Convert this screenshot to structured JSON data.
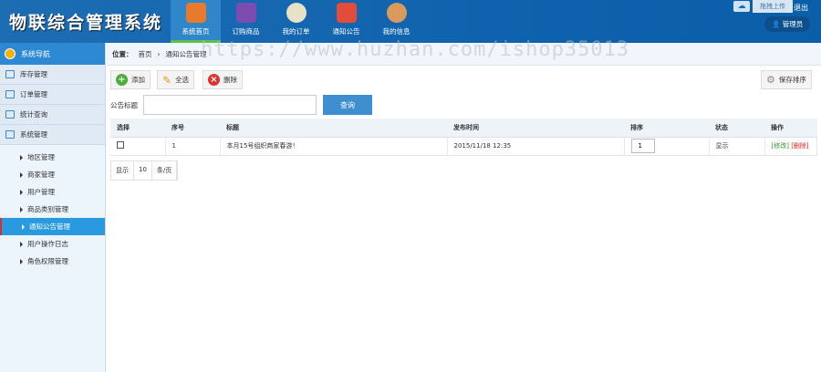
{
  "app_title": "物联综合管理系统",
  "nav": [
    {
      "label": "系统首页",
      "icon": "home-icon",
      "color": "#e87a2f"
    },
    {
      "label": "订购商品",
      "icon": "phone-icon",
      "color": "#7b4db0"
    },
    {
      "label": "我的订单",
      "icon": "support-icon",
      "color": "#e7e1c8"
    },
    {
      "label": "通知公告",
      "icon": "megaphone-icon",
      "color": "#e24c3a"
    },
    {
      "label": "我的信息",
      "icon": "user-icon",
      "color": "#d99a5b"
    }
  ],
  "top": {
    "upload": "拖拽上传",
    "logout": "退出",
    "user": "管理员"
  },
  "sidebar": {
    "title": "系统导航",
    "menus": [
      "库存管理",
      "订单管理",
      "统计查询",
      "系统管理"
    ],
    "subs": [
      "地区管理",
      "商家管理",
      "用户管理",
      "商品类别管理",
      "通知公告管理",
      "用户操作日志",
      "角色权限管理"
    ]
  },
  "breadcrumb": {
    "label": "位置：",
    "home": "首页",
    "sep": "›",
    "current": "通知公告管理"
  },
  "toolbar": {
    "add": "添加",
    "select_all": "全选",
    "delete": "删除",
    "save_sort": "保存排序"
  },
  "search": {
    "label": "公告标题",
    "value": "",
    "button": "查询"
  },
  "table": {
    "headers": [
      "选择",
      "序号",
      "标题",
      "发布时间",
      "排序",
      "状态",
      "操作"
    ],
    "rows": [
      {
        "no": "1",
        "title": "本月15号组织商家春游！",
        "time": "2015/11/18 12:35",
        "sort": "1",
        "status": "显示",
        "edit": "[修改]",
        "del": "[删除]"
      }
    ]
  },
  "pager": {
    "show": "显示",
    "size": "10",
    "unit": "条/页"
  },
  "watermark": "https://www.huzhan.com/ishop35013"
}
